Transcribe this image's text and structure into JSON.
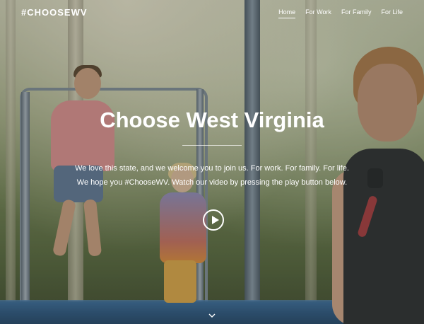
{
  "header": {
    "logo": "#CHOOSEWV",
    "nav": [
      {
        "label": "Home",
        "active": true
      },
      {
        "label": "For Work"
      },
      {
        "label": "For Family"
      },
      {
        "label": "For Life"
      }
    ]
  },
  "hero": {
    "title": "Choose West Virginia",
    "line1": "We love this state, and we welcome you to join us. For work. For family. For life.",
    "line2": "We hope you #ChooseWV. Watch our video by pressing the play button below."
  },
  "icons": {
    "play": "play-circle-icon",
    "scroll": "chevron-down-icon"
  }
}
